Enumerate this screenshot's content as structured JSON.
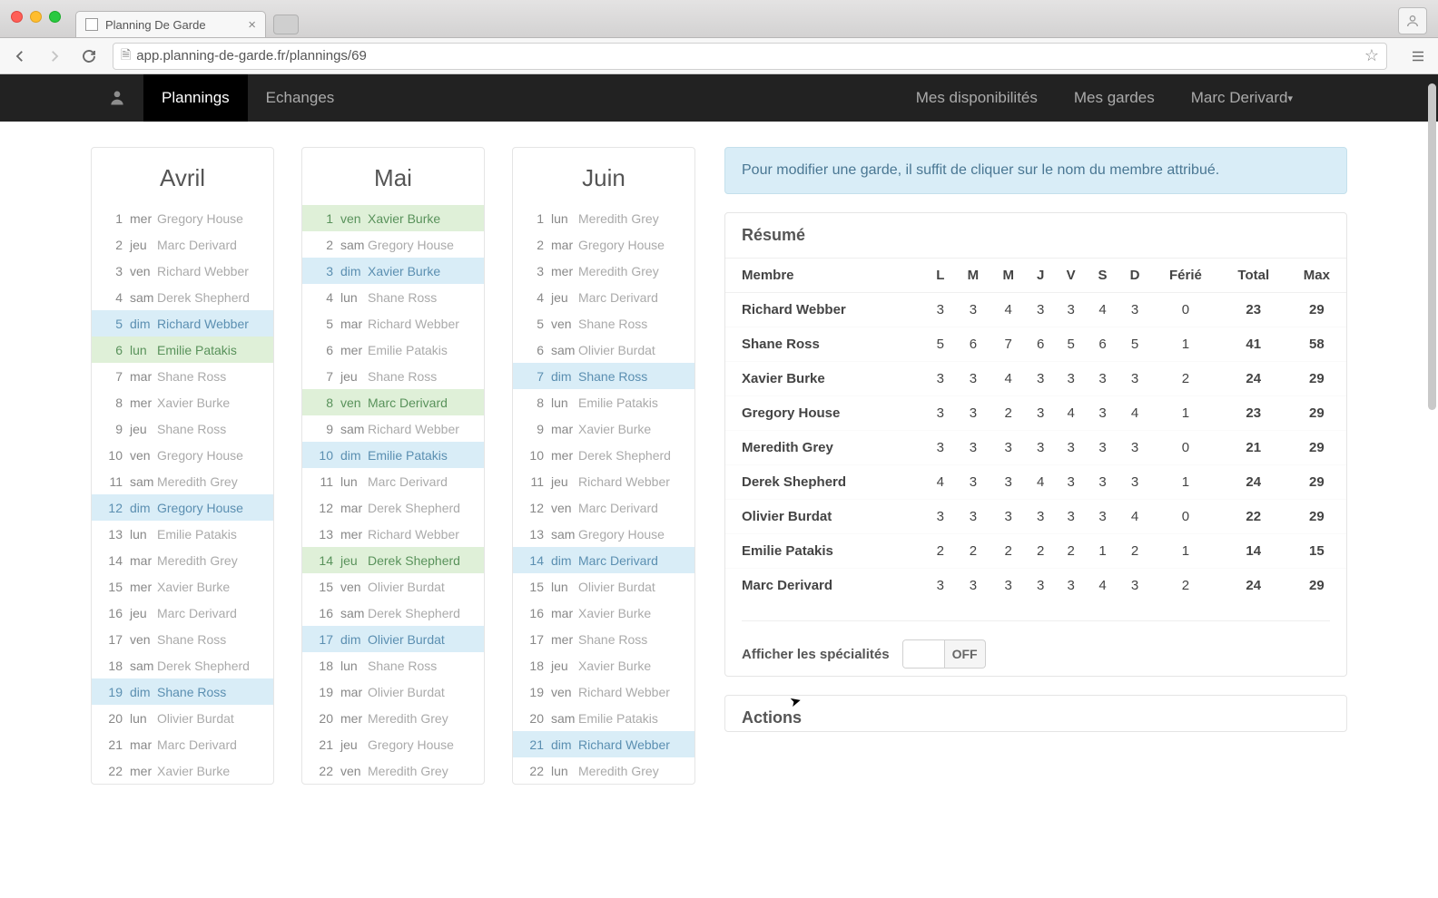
{
  "browser": {
    "tab_title": "Planning De Garde",
    "url": "app.planning-de-garde.fr/plannings/69"
  },
  "nav": {
    "items_left": [
      "Plannings",
      "Echanges"
    ],
    "items_right": [
      "Mes disponibilités",
      "Mes gardes"
    ],
    "user": "Marc Derivard"
  },
  "info_banner": "Pour modifier une garde, il suffit de cliquer sur le nom du membre attribué.",
  "months": [
    {
      "name": "Avril",
      "days": [
        {
          "n": 1,
          "d": "mer",
          "m": "Gregory House",
          "hl": ""
        },
        {
          "n": 2,
          "d": "jeu",
          "m": "Marc Derivard",
          "hl": ""
        },
        {
          "n": 3,
          "d": "ven",
          "m": "Richard Webber",
          "hl": ""
        },
        {
          "n": 4,
          "d": "sam",
          "m": "Derek Shepherd",
          "hl": ""
        },
        {
          "n": 5,
          "d": "dim",
          "m": "Richard Webber",
          "hl": "blue"
        },
        {
          "n": 6,
          "d": "lun",
          "m": "Emilie Patakis",
          "hl": "green"
        },
        {
          "n": 7,
          "d": "mar",
          "m": "Shane Ross",
          "hl": ""
        },
        {
          "n": 8,
          "d": "mer",
          "m": "Xavier Burke",
          "hl": ""
        },
        {
          "n": 9,
          "d": "jeu",
          "m": "Shane Ross",
          "hl": ""
        },
        {
          "n": 10,
          "d": "ven",
          "m": "Gregory House",
          "hl": ""
        },
        {
          "n": 11,
          "d": "sam",
          "m": "Meredith Grey",
          "hl": ""
        },
        {
          "n": 12,
          "d": "dim",
          "m": "Gregory House",
          "hl": "blue"
        },
        {
          "n": 13,
          "d": "lun",
          "m": "Emilie Patakis",
          "hl": ""
        },
        {
          "n": 14,
          "d": "mar",
          "m": "Meredith Grey",
          "hl": ""
        },
        {
          "n": 15,
          "d": "mer",
          "m": "Xavier Burke",
          "hl": ""
        },
        {
          "n": 16,
          "d": "jeu",
          "m": "Marc Derivard",
          "hl": ""
        },
        {
          "n": 17,
          "d": "ven",
          "m": "Shane Ross",
          "hl": ""
        },
        {
          "n": 18,
          "d": "sam",
          "m": "Derek Shepherd",
          "hl": ""
        },
        {
          "n": 19,
          "d": "dim",
          "m": "Shane Ross",
          "hl": "blue"
        },
        {
          "n": 20,
          "d": "lun",
          "m": "Olivier Burdat",
          "hl": ""
        },
        {
          "n": 21,
          "d": "mar",
          "m": "Marc Derivard",
          "hl": ""
        },
        {
          "n": 22,
          "d": "mer",
          "m": "Xavier Burke",
          "hl": ""
        }
      ]
    },
    {
      "name": "Mai",
      "days": [
        {
          "n": 1,
          "d": "ven",
          "m": "Xavier Burke",
          "hl": "green"
        },
        {
          "n": 2,
          "d": "sam",
          "m": "Gregory House",
          "hl": ""
        },
        {
          "n": 3,
          "d": "dim",
          "m": "Xavier Burke",
          "hl": "blue"
        },
        {
          "n": 4,
          "d": "lun",
          "m": "Shane Ross",
          "hl": ""
        },
        {
          "n": 5,
          "d": "mar",
          "m": "Richard Webber",
          "hl": ""
        },
        {
          "n": 6,
          "d": "mer",
          "m": "Emilie Patakis",
          "hl": ""
        },
        {
          "n": 7,
          "d": "jeu",
          "m": "Shane Ross",
          "hl": ""
        },
        {
          "n": 8,
          "d": "ven",
          "m": "Marc Derivard",
          "hl": "green"
        },
        {
          "n": 9,
          "d": "sam",
          "m": "Richard Webber",
          "hl": ""
        },
        {
          "n": 10,
          "d": "dim",
          "m": "Emilie Patakis",
          "hl": "blue"
        },
        {
          "n": 11,
          "d": "lun",
          "m": "Marc Derivard",
          "hl": ""
        },
        {
          "n": 12,
          "d": "mar",
          "m": "Derek Shepherd",
          "hl": ""
        },
        {
          "n": 13,
          "d": "mer",
          "m": "Richard Webber",
          "hl": ""
        },
        {
          "n": 14,
          "d": "jeu",
          "m": "Derek Shepherd",
          "hl": "green"
        },
        {
          "n": 15,
          "d": "ven",
          "m": "Olivier Burdat",
          "hl": ""
        },
        {
          "n": 16,
          "d": "sam",
          "m": "Derek Shepherd",
          "hl": ""
        },
        {
          "n": 17,
          "d": "dim",
          "m": "Olivier Burdat",
          "hl": "blue"
        },
        {
          "n": 18,
          "d": "lun",
          "m": "Shane Ross",
          "hl": ""
        },
        {
          "n": 19,
          "d": "mar",
          "m": "Olivier Burdat",
          "hl": ""
        },
        {
          "n": 20,
          "d": "mer",
          "m": "Meredith Grey",
          "hl": ""
        },
        {
          "n": 21,
          "d": "jeu",
          "m": "Gregory House",
          "hl": ""
        },
        {
          "n": 22,
          "d": "ven",
          "m": "Meredith Grey",
          "hl": ""
        }
      ]
    },
    {
      "name": "Juin",
      "days": [
        {
          "n": 1,
          "d": "lun",
          "m": "Meredith Grey",
          "hl": ""
        },
        {
          "n": 2,
          "d": "mar",
          "m": "Gregory House",
          "hl": ""
        },
        {
          "n": 3,
          "d": "mer",
          "m": "Meredith Grey",
          "hl": ""
        },
        {
          "n": 4,
          "d": "jeu",
          "m": "Marc Derivard",
          "hl": ""
        },
        {
          "n": 5,
          "d": "ven",
          "m": "Shane Ross",
          "hl": ""
        },
        {
          "n": 6,
          "d": "sam",
          "m": "Olivier Burdat",
          "hl": ""
        },
        {
          "n": 7,
          "d": "dim",
          "m": "Shane Ross",
          "hl": "blue"
        },
        {
          "n": 8,
          "d": "lun",
          "m": "Emilie Patakis",
          "hl": ""
        },
        {
          "n": 9,
          "d": "mar",
          "m": "Xavier Burke",
          "hl": ""
        },
        {
          "n": 10,
          "d": "mer",
          "m": "Derek Shepherd",
          "hl": ""
        },
        {
          "n": 11,
          "d": "jeu",
          "m": "Richard Webber",
          "hl": ""
        },
        {
          "n": 12,
          "d": "ven",
          "m": "Marc Derivard",
          "hl": ""
        },
        {
          "n": 13,
          "d": "sam",
          "m": "Gregory House",
          "hl": ""
        },
        {
          "n": 14,
          "d": "dim",
          "m": "Marc Derivard",
          "hl": "blue"
        },
        {
          "n": 15,
          "d": "lun",
          "m": "Olivier Burdat",
          "hl": ""
        },
        {
          "n": 16,
          "d": "mar",
          "m": "Xavier Burke",
          "hl": ""
        },
        {
          "n": 17,
          "d": "mer",
          "m": "Shane Ross",
          "hl": ""
        },
        {
          "n": 18,
          "d": "jeu",
          "m": "Xavier Burke",
          "hl": ""
        },
        {
          "n": 19,
          "d": "ven",
          "m": "Richard Webber",
          "hl": ""
        },
        {
          "n": 20,
          "d": "sam",
          "m": "Emilie Patakis",
          "hl": ""
        },
        {
          "n": 21,
          "d": "dim",
          "m": "Richard Webber",
          "hl": "blue"
        },
        {
          "n": 22,
          "d": "lun",
          "m": "Meredith Grey",
          "hl": ""
        }
      ]
    }
  ],
  "resume": {
    "title": "Résumé",
    "headers": [
      "Membre",
      "L",
      "M",
      "M",
      "J",
      "V",
      "S",
      "D",
      "Férié",
      "Total",
      "Max"
    ],
    "rows": [
      {
        "name": "Richard Webber",
        "vals": [
          3,
          3,
          4,
          3,
          3,
          4,
          3,
          0
        ],
        "total": 23,
        "max": 29
      },
      {
        "name": "Shane Ross",
        "vals": [
          5,
          6,
          7,
          6,
          5,
          6,
          5,
          1
        ],
        "total": 41,
        "max": 58
      },
      {
        "name": "Xavier Burke",
        "vals": [
          3,
          3,
          4,
          3,
          3,
          3,
          3,
          2
        ],
        "total": 24,
        "max": 29
      },
      {
        "name": "Gregory House",
        "vals": [
          3,
          3,
          2,
          3,
          4,
          3,
          4,
          1
        ],
        "total": 23,
        "max": 29
      },
      {
        "name": "Meredith Grey",
        "vals": [
          3,
          3,
          3,
          3,
          3,
          3,
          3,
          0
        ],
        "total": 21,
        "max": 29
      },
      {
        "name": "Derek Shepherd",
        "vals": [
          4,
          3,
          3,
          4,
          3,
          3,
          3,
          1
        ],
        "total": 24,
        "max": 29
      },
      {
        "name": "Olivier Burdat",
        "vals": [
          3,
          3,
          3,
          3,
          3,
          3,
          4,
          0
        ],
        "total": 22,
        "max": 29
      },
      {
        "name": "Emilie Patakis",
        "vals": [
          2,
          2,
          2,
          2,
          2,
          1,
          2,
          1
        ],
        "total": 14,
        "max": 15
      },
      {
        "name": "Marc Derivard",
        "vals": [
          3,
          3,
          3,
          3,
          3,
          4,
          3,
          2
        ],
        "total": 24,
        "max": 29
      }
    ]
  },
  "specialties": {
    "label": "Afficher les spécialités",
    "toggle_state": "OFF"
  },
  "actions": {
    "title": "Actions"
  }
}
